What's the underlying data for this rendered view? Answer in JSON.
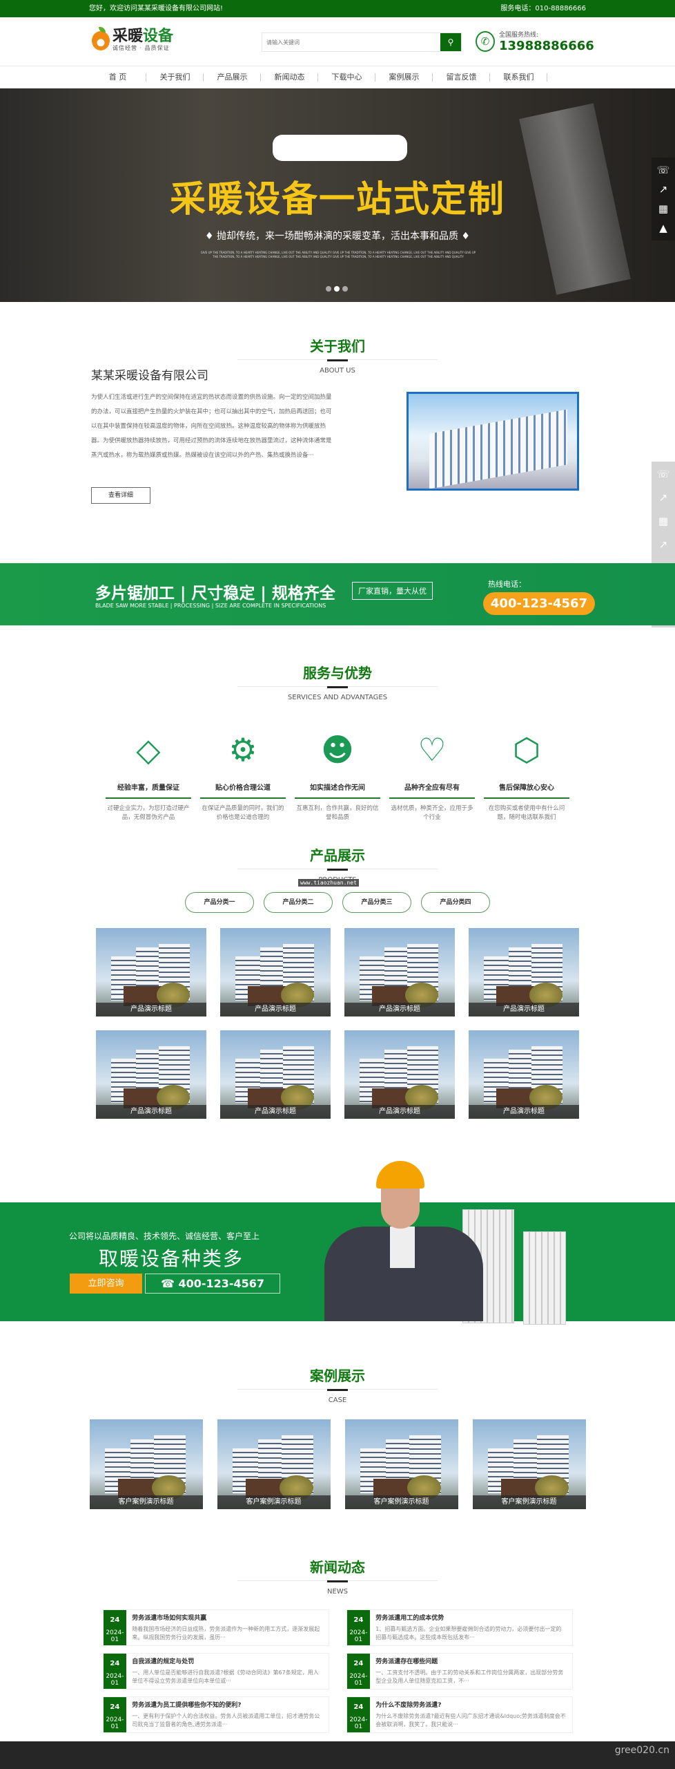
{
  "topbar": {
    "welcome": "您好，欢迎访问某某采暖设备有限公司网站!",
    "service_phone": "服务电话：010-88886666"
  },
  "header": {
    "logo_main_1": "采暖",
    "logo_main_2": "设备",
    "logo_slogan": "诚信经营 · 品质保证",
    "search_placeholder": "请输入关键词",
    "hotline_label": "全国服务热线:",
    "hotline": "13988886666"
  },
  "nav": [
    "首 页",
    "关于我们",
    "产品展示",
    "新闻动态",
    "下载中心",
    "案例展示",
    "留言反馈",
    "联系我们"
  ],
  "banner": {
    "title": "采暖设备一站式定制",
    "subtitle": "♦ 抛却传统，来一场酣畅淋漓的采暖变革，活出本事和品质 ♦",
    "en": "GIVE UP THE TRADITION, TO A HEARTY HEATING CHANGE, LIVE OUT THE ABILITY AND QUALITY GIVE UP THE TRADITION, TO A HEARTY HEATING CHANGE, LIVE OUT THE ABILITY AND QUALITY GIVE UP THE TRADITION, TO A HEARTY HEATING CHANGE, LIVE OUT THE ABILITY AND QUALITY GIVE UP THE TRADITION, TO A HEARTY HEATING CHANGE, LIVE OUT THE ABILITY AND QUALITY",
    "active_slide": 2,
    "slides": 3
  },
  "about": {
    "title": "关于我们",
    "en": "ABOUT US",
    "company": "某某采暖设备有限公司",
    "text": "为使人们生活或进行生产的空间保持在适宜的热状态而设置的供热设施。向一定的空间加热量的办法，可以直接把产生热量的火炉装在其中；也可以抽出其中的空气，加热后再送回；也可以在其中装置保持在较高温度的物体，向所在空间放热。这种温度较高的物体称为供暖放热器。为使供暖放热器持续放热，可用经过预热的流体连续地在放热器里流过，这种流体通常是蒸汽或热水，称为载热媒质或热媒。热媒被设在该空间以外的产热、集热或换热设备···",
    "more": "查看详细"
  },
  "band": {
    "headline": "多片锯加工 | 尺寸稳定 | 规格齐全",
    "en": "BLADE SAW MORE STABLE | PROCESSING | SIZE ARE COMPLETE IN SPECIFICATIONS",
    "tag": "厂家直销，量大从优",
    "hotline_label": "热线电话：",
    "phone": "400-123-4567"
  },
  "services": {
    "title": "服务与优势",
    "en": "SERVICES AND ADVANTAGES",
    "items": [
      {
        "icon": "diamond-icon",
        "title": "经验丰富，质量保证",
        "text": "过硬企业实力，为您打造过硬产品，无假冒伪劣产品"
      },
      {
        "icon": "gear-icon",
        "title": "贴心价格合理公道",
        "text": "在保证产品质量的同时，我们的价格也是公道合理的"
      },
      {
        "icon": "users-icon",
        "title": "如实描述合作无间",
        "text": "互惠互利，合作共赢，良好的信誉和品质"
      },
      {
        "icon": "handshake-icon",
        "title": "品种齐全应有尽有",
        "text": "选材优质，种类齐全，应用于多个行业"
      },
      {
        "icon": "sale-icon",
        "title": "售后保障放心安心",
        "text": "在您购买或者使用中有什么问题，随时电话联系我们"
      }
    ]
  },
  "products": {
    "title": "产品展示",
    "en": "PRODUCTS",
    "watermark": "www.tiaozhuan.net",
    "tabs": [
      "产品分类一",
      "产品分类二",
      "产品分类三",
      "产品分类四"
    ],
    "items": [
      "产品演示标题",
      "产品演示标题",
      "产品演示标题",
      "产品演示标题",
      "产品演示标题",
      "产品演示标题",
      "产品演示标题",
      "产品演示标题"
    ]
  },
  "promo": {
    "slogan": "公司将以品质精良、技术领先、诚信经营、客户至上",
    "title": "取暖设备种类多",
    "consult": "立即咨询",
    "phone": "☎ 400-123-4567"
  },
  "cases": {
    "title": "案例展示",
    "en": "CASE",
    "items": [
      "客户案例演示标题",
      "客户案例演示标题",
      "客户案例演示标题",
      "客户案例演示标题"
    ]
  },
  "news": {
    "title": "新闻动态",
    "en": "NEWS",
    "items": [
      {
        "day": "24",
        "ym": "2024-01",
        "title": "劳务派遣市场如何实现共赢",
        "text": "随着我国市场经济的日益成熟，劳务派遣作为一种新的用工方式，逐渐发展起来。纵观我国劳务行业的发展，虽历···"
      },
      {
        "day": "24",
        "ym": "2024-01",
        "title": "劳务派遣用工的成本优势",
        "text": "1、招募与甄选方面。企业如果想要雇佣到合适的劳动力，必须要付出一定的招募与甄选成本。这些成本既包括发布···"
      },
      {
        "day": "24",
        "ym": "2024-01",
        "title": "自我派遣的规定与处罚",
        "text": "一、用人单位是否能够进行自我派遣?根据《劳动合同法》第67条规定，用人单位不得设立劳务派遣单位向本单位或···"
      },
      {
        "day": "24",
        "ym": "2024-01",
        "title": "劳务派遣存在哪些问题",
        "text": "一、工资支付不透明。由于工的劳动关系和工作岗位分属两家，出现部分劳务型企业及用人单位随意克扣工资，不···"
      },
      {
        "day": "24",
        "ym": "2024-01",
        "title": "劳务派遣为员工提供哪些你不知的便利?",
        "text": "一、更有利于保护个人的合法权益。劳务人员被派遣用工单位，招才通劳务公司就充当了监督者的角色,通劳务派遣···"
      },
      {
        "day": "24",
        "ym": "2024-01",
        "title": "为什么不废除劳务派遣?",
        "text": "为什么不废除劳务派遣?最近有些人问广东招才通说&ldquo;劳务派遣制度会不会被取消啊，我笑了。我只能说···"
      }
    ]
  },
  "footer": {
    "watermark": "gree020.cn"
  },
  "side_tools": [
    "headset-icon",
    "share-icon",
    "qrcode-icon",
    "rocket-icon"
  ],
  "colors": {
    "brand_green": "#0b6a0b",
    "accent_orange": "#f7a21b",
    "band_green": "#1b9a4a",
    "banner_yellow": "#f5c518"
  }
}
